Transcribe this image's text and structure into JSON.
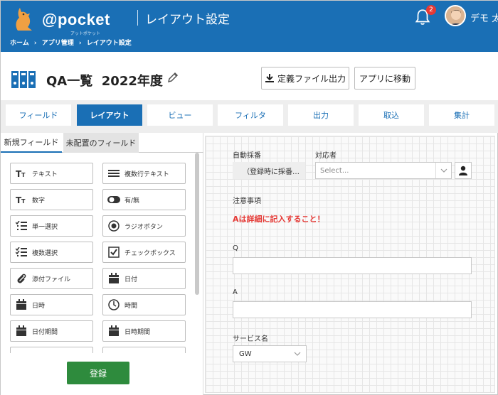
{
  "header": {
    "logo_text": "@pocket",
    "logo_sub": "アットポケット",
    "title": "レイアウト設定",
    "breadcrumb": [
      "ホーム",
      "›",
      "アプリ管理",
      "›",
      "レイアウト設定"
    ],
    "notification_count": "2",
    "user_name": "デモ 太"
  },
  "page": {
    "title": "QA一覧  2022年度",
    "export_button": "定義ファイル出力",
    "goto_app_button": "アプリに移動"
  },
  "tabs": [
    {
      "label": "フィールド",
      "active": false
    },
    {
      "label": "レイアウト",
      "active": true
    },
    {
      "label": "ビュー",
      "active": false
    },
    {
      "label": "フィルタ",
      "active": false
    },
    {
      "label": "出力",
      "active": false
    },
    {
      "label": "取込",
      "active": false
    },
    {
      "label": "集計",
      "active": false
    }
  ],
  "left_panel": {
    "subtabs": [
      "新規フィールド",
      "未配置のフィールド"
    ],
    "field_types": [
      {
        "label": "テキスト",
        "icon": "text-icon"
      },
      {
        "label": "複数行テキスト",
        "icon": "multiline-text-icon"
      },
      {
        "label": "数字",
        "icon": "number-icon"
      },
      {
        "label": "有/無",
        "icon": "toggle-icon"
      },
      {
        "label": "単一選択",
        "icon": "single-select-icon"
      },
      {
        "label": "ラジオボタン",
        "icon": "radio-icon"
      },
      {
        "label": "複数選択",
        "icon": "multi-select-icon"
      },
      {
        "label": "チェックボックス",
        "icon": "checkbox-icon"
      },
      {
        "label": "添付ファイル",
        "icon": "attachment-icon"
      },
      {
        "label": "日付",
        "icon": "calendar-icon"
      },
      {
        "label": "日時",
        "icon": "calendar-icon"
      },
      {
        "label": "時間",
        "icon": "clock-icon"
      },
      {
        "label": "日付期間",
        "icon": "calendar-icon"
      },
      {
        "label": "日時期間",
        "icon": "calendar-icon"
      }
    ],
    "register_button": "登録"
  },
  "form": {
    "auto_number_label": "自動採番",
    "auto_number_value": "（登録時に採番…",
    "assignee_label": "対応者",
    "assignee_placeholder": "Select...",
    "notes_label": "注意事項",
    "notes_text": "Aは詳細に記入すること！",
    "q_label": "Q",
    "a_label": "A",
    "service_label": "サービス名",
    "service_value": "GW"
  },
  "colors": {
    "primary": "#1a6fb5",
    "register": "#2e8b3d",
    "notice": "#e53935"
  }
}
